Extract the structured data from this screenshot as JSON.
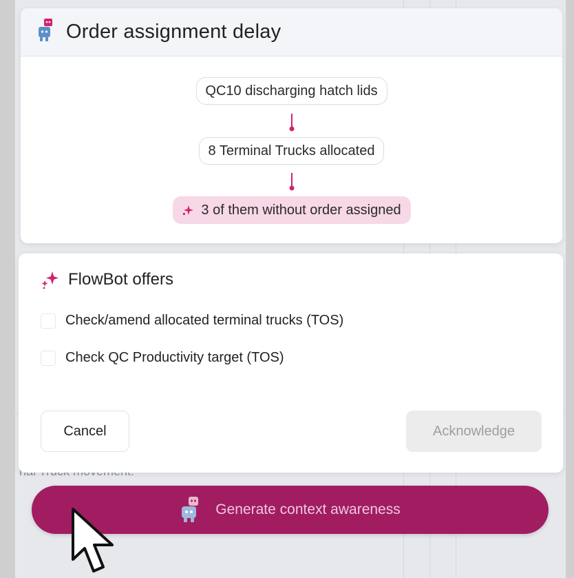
{
  "alert": {
    "title": "Order assignment delay",
    "chain": {
      "step1": "QC10 discharging hatch lids",
      "step2": "8 Terminal Trucks allocated",
      "step3": "3 of them without order assigned"
    }
  },
  "offers": {
    "title": "FlowBot offers",
    "options": [
      {
        "label": "Check/amend allocated terminal trucks (TOS)",
        "checked": false
      },
      {
        "label": "Check QC Productivity target (TOS)",
        "checked": false
      }
    ],
    "cancel_label": "Cancel",
    "acknowledge_label": "Acknowledge"
  },
  "generate_button": {
    "label": "Generate context awareness"
  },
  "background": {
    "partial_text": "nal Truck movement!"
  },
  "colors": {
    "brand": "#a21c62",
    "accent_pink": "#d3226e",
    "highlight_bg": "#f7d8e6",
    "disabled_bg": "#ececec"
  },
  "icons": {
    "header": "robot-icon",
    "offers": "sparkle-icon",
    "highlight": "sparkle-icon",
    "generate": "robot-icon",
    "pointer": "mouse-pointer-icon"
  }
}
